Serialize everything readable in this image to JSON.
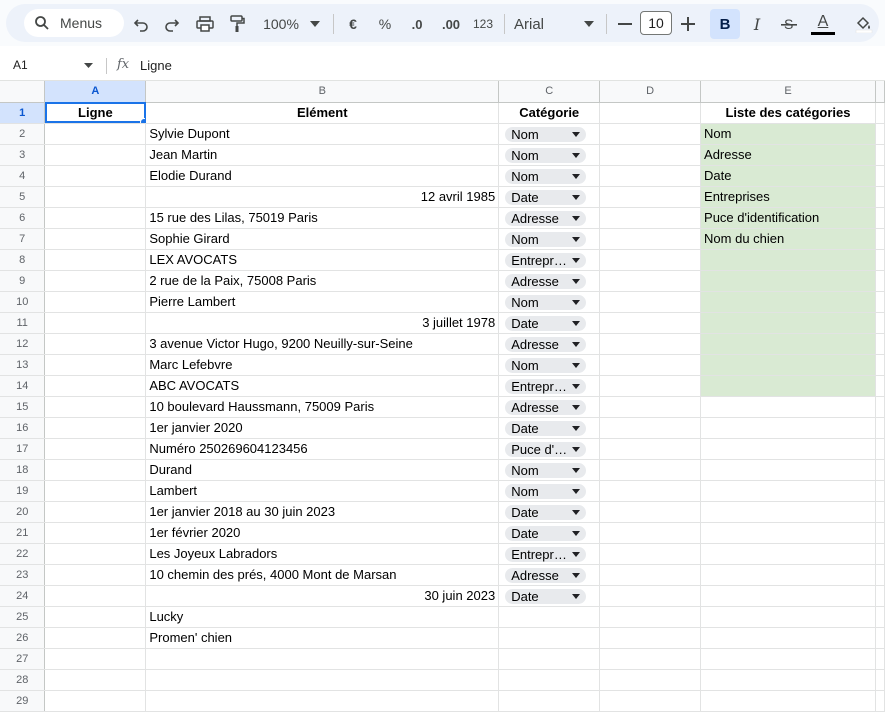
{
  "toolbar": {
    "menus_label": "Menus",
    "zoom": "100%",
    "currency": "€",
    "percent": "%",
    "dec_decrease": ".0",
    "dec_increase": ".00",
    "number_format": "123",
    "font_name": "Arial",
    "font_size": "10",
    "bold": "B",
    "italic": "I",
    "text_color": "A"
  },
  "formula_bar": {
    "cell_ref": "A1",
    "value": "Ligne"
  },
  "columns": [
    "A",
    "B",
    "C",
    "D",
    "E"
  ],
  "rows": [
    {
      "num": "1",
      "a": "Ligne",
      "b": "Elément",
      "c": "Catégorie",
      "d": "",
      "e": "Liste des catégories"
    },
    {
      "num": "2",
      "a": "",
      "b": "Sylvie Dupont",
      "c": "Nom",
      "d": "",
      "e": "Nom"
    },
    {
      "num": "3",
      "a": "",
      "b": "Jean Martin",
      "c": "Nom",
      "d": "",
      "e": "Adresse"
    },
    {
      "num": "4",
      "a": "",
      "b": "Elodie Durand",
      "c": "Nom",
      "d": "",
      "e": "Date"
    },
    {
      "num": "5",
      "a": "",
      "b": "12 avril 1985",
      "c": "Date",
      "d": "",
      "e": "Entreprises"
    },
    {
      "num": "6",
      "a": "",
      "b": "15 rue des Lilas, 75019 Paris",
      "c": "Adresse",
      "d": "",
      "e": "Puce d'identification"
    },
    {
      "num": "7",
      "a": "",
      "b": "Sophie Girard",
      "c": "Nom",
      "d": "",
      "e": "Nom du chien"
    },
    {
      "num": "8",
      "a": "",
      "b": "LEX AVOCATS",
      "c": "Entreprises",
      "d": "",
      "e": ""
    },
    {
      "num": "9",
      "a": "",
      "b": "2 rue de la Paix, 75008 Paris",
      "c": "Adresse",
      "d": "",
      "e": ""
    },
    {
      "num": "10",
      "a": "",
      "b": "Pierre Lambert",
      "c": "Nom",
      "d": "",
      "e": ""
    },
    {
      "num": "11",
      "a": "",
      "b": "3 juillet 1978",
      "c": "Date",
      "d": "",
      "e": ""
    },
    {
      "num": "12",
      "a": "",
      "b": "3 avenue Victor Hugo, 9200 Neuilly-sur-Seine",
      "c": "Adresse",
      "d": "",
      "e": ""
    },
    {
      "num": "13",
      "a": "",
      "b": "Marc Lefebvre",
      "c": "Nom",
      "d": "",
      "e": ""
    },
    {
      "num": "14",
      "a": "",
      "b": "ABC AVOCATS",
      "c": "Entreprises",
      "d": "",
      "e": ""
    },
    {
      "num": "15",
      "a": "",
      "b": "10 boulevard Haussmann, 75009 Paris",
      "c": "Adresse",
      "d": "",
      "e": ""
    },
    {
      "num": "16",
      "a": "",
      "b": "1er janvier 2020",
      "c": "Date",
      "d": "",
      "e": ""
    },
    {
      "num": "17",
      "a": "",
      "b": "Numéro 250269604123456",
      "c": "Puce d'identification",
      "d": "",
      "e": ""
    },
    {
      "num": "18",
      "a": "",
      "b": "Durand",
      "c": "Nom",
      "d": "",
      "e": ""
    },
    {
      "num": "19",
      "a": "",
      "b": "Lambert",
      "c": "Nom",
      "d": "",
      "e": ""
    },
    {
      "num": "20",
      "a": "",
      "b": "1er janvier 2018 au 30 juin 2023",
      "c": "Date",
      "d": "",
      "e": ""
    },
    {
      "num": "21",
      "a": "",
      "b": "1er février 2020",
      "c": "Date",
      "d": "",
      "e": ""
    },
    {
      "num": "22",
      "a": "",
      "b": "Les Joyeux Labradors",
      "c": "Entreprises",
      "d": "",
      "e": ""
    },
    {
      "num": "23",
      "a": "",
      "b": "10 chemin des prés, 4000 Mont de Marsan",
      "c": "Adresse",
      "d": "",
      "e": ""
    },
    {
      "num": "24",
      "a": "",
      "b": "30 juin 2023",
      "c": "Date",
      "d": "",
      "e": ""
    },
    {
      "num": "25",
      "a": "",
      "b": "Lucky",
      "c": "",
      "d": "",
      "e": ""
    },
    {
      "num": "26",
      "a": "",
      "b": "Promen' chien",
      "c": "",
      "d": "",
      "e": ""
    },
    {
      "num": "27",
      "a": "",
      "b": "",
      "c": "",
      "d": "",
      "e": ""
    },
    {
      "num": "28",
      "a": "",
      "b": "",
      "c": "",
      "d": "",
      "e": ""
    },
    {
      "num": "29",
      "a": "",
      "b": "",
      "c": "",
      "d": "",
      "e": ""
    }
  ],
  "right_aligned_rows": [
    "5",
    "11",
    "24"
  ],
  "green_rows": [
    "2",
    "3",
    "4",
    "5",
    "6",
    "7",
    "8",
    "9",
    "10",
    "11",
    "12",
    "13",
    "14"
  ],
  "colors": {
    "accent": "#1a73e8",
    "selected_header": "#d3e3fd",
    "category_list_fill": "#d9ead3",
    "chip": "#e8eaed",
    "toolbar_bg": "#edf2fa"
  }
}
